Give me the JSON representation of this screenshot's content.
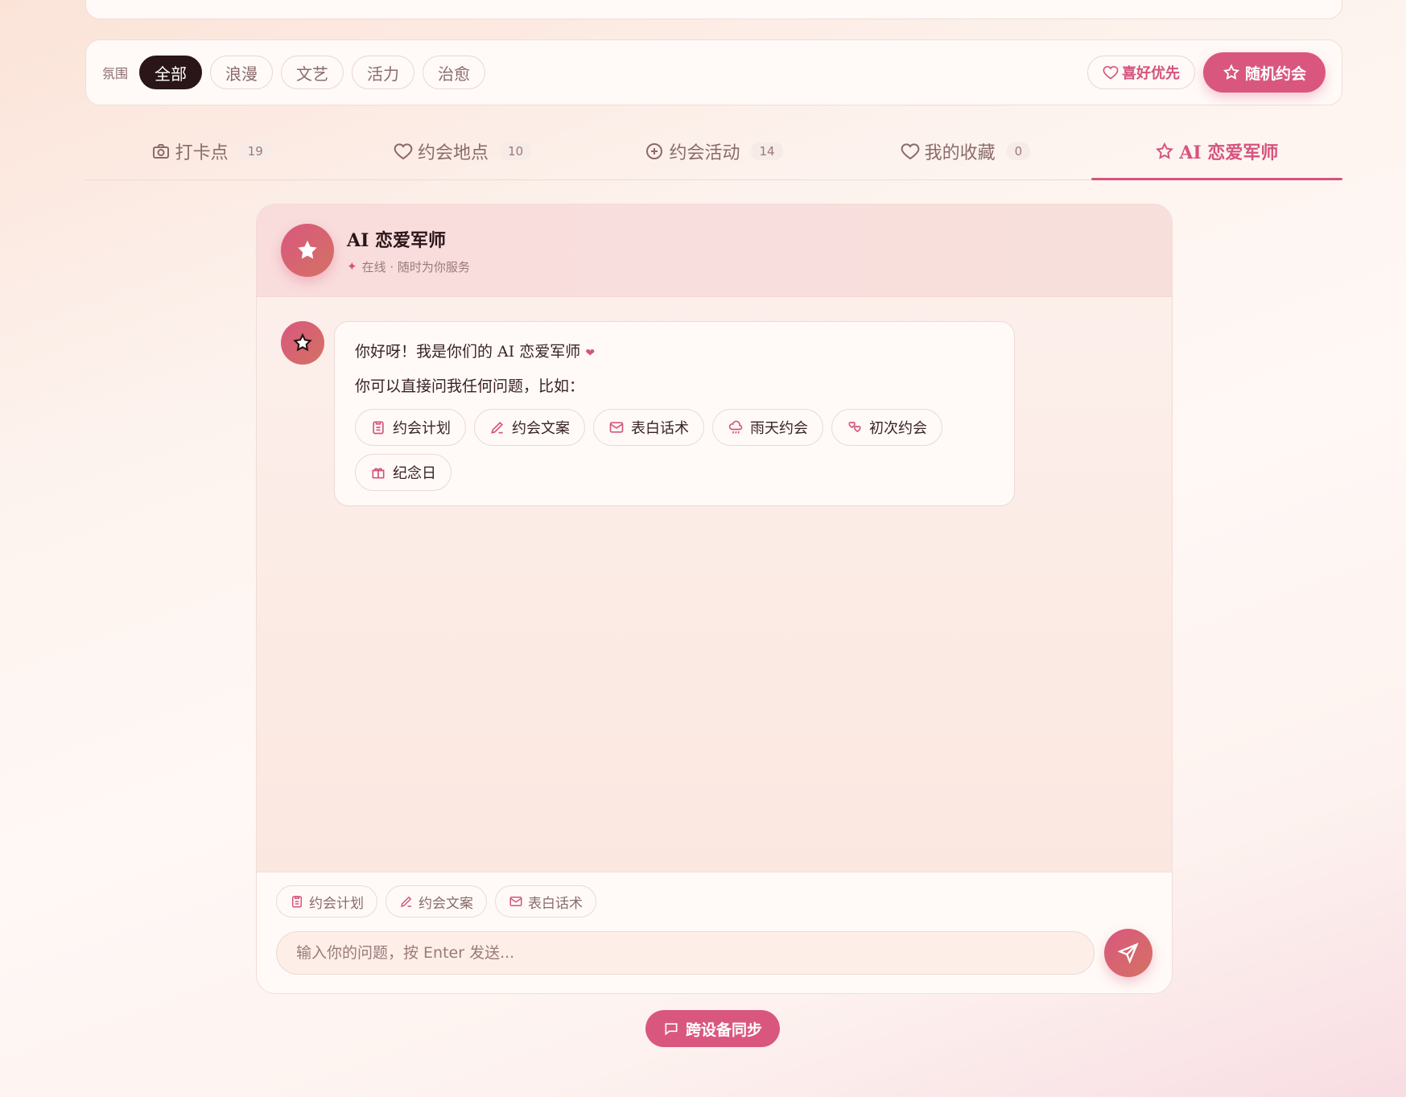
{
  "filter": {
    "label": "氛围",
    "chips": [
      "全部",
      "浪漫",
      "文艺",
      "活力",
      "治愈"
    ],
    "pref_label": "喜好优先",
    "random_label": "随机约会"
  },
  "tabs": [
    {
      "label": "打卡点",
      "count": "19",
      "icon": "camera-icon"
    },
    {
      "label": "约会地点",
      "count": "10",
      "icon": "heart-icon"
    },
    {
      "label": "约会活动",
      "count": "14",
      "icon": "plus-circle-icon"
    },
    {
      "label": "我的收藏",
      "count": "0",
      "icon": "heart-icon"
    },
    {
      "label": "AI 恋爱军师",
      "icon": "star-icon"
    }
  ],
  "chat": {
    "title": "AI 恋爱军师",
    "status": "在线 · 随时为你服务",
    "greeting": "你好呀！我是你们的 AI 恋爱军师",
    "prompt": "你可以直接问我任何问题，比如：",
    "suggestions": [
      {
        "label": "约会计划",
        "icon": "clipboard-icon"
      },
      {
        "label": "约会文案",
        "icon": "pen-icon"
      },
      {
        "label": "表白话术",
        "icon": "mail-icon"
      },
      {
        "label": "雨天约会",
        "icon": "rain-icon"
      },
      {
        "label": "初次约会",
        "icon": "hearts-icon"
      },
      {
        "label": "纪念日",
        "icon": "gift-icon"
      }
    ],
    "quick": [
      {
        "label": "约会计划",
        "icon": "clipboard-icon"
      },
      {
        "label": "约会文案",
        "icon": "pen-icon"
      },
      {
        "label": "表白话术",
        "icon": "mail-icon"
      }
    ],
    "input_placeholder": "输入你的问题，按 Enter 发送..."
  },
  "sync_label": "跨设备同步",
  "colors": {
    "accent": "#d9577f",
    "dark_chip": "#2a1518"
  }
}
